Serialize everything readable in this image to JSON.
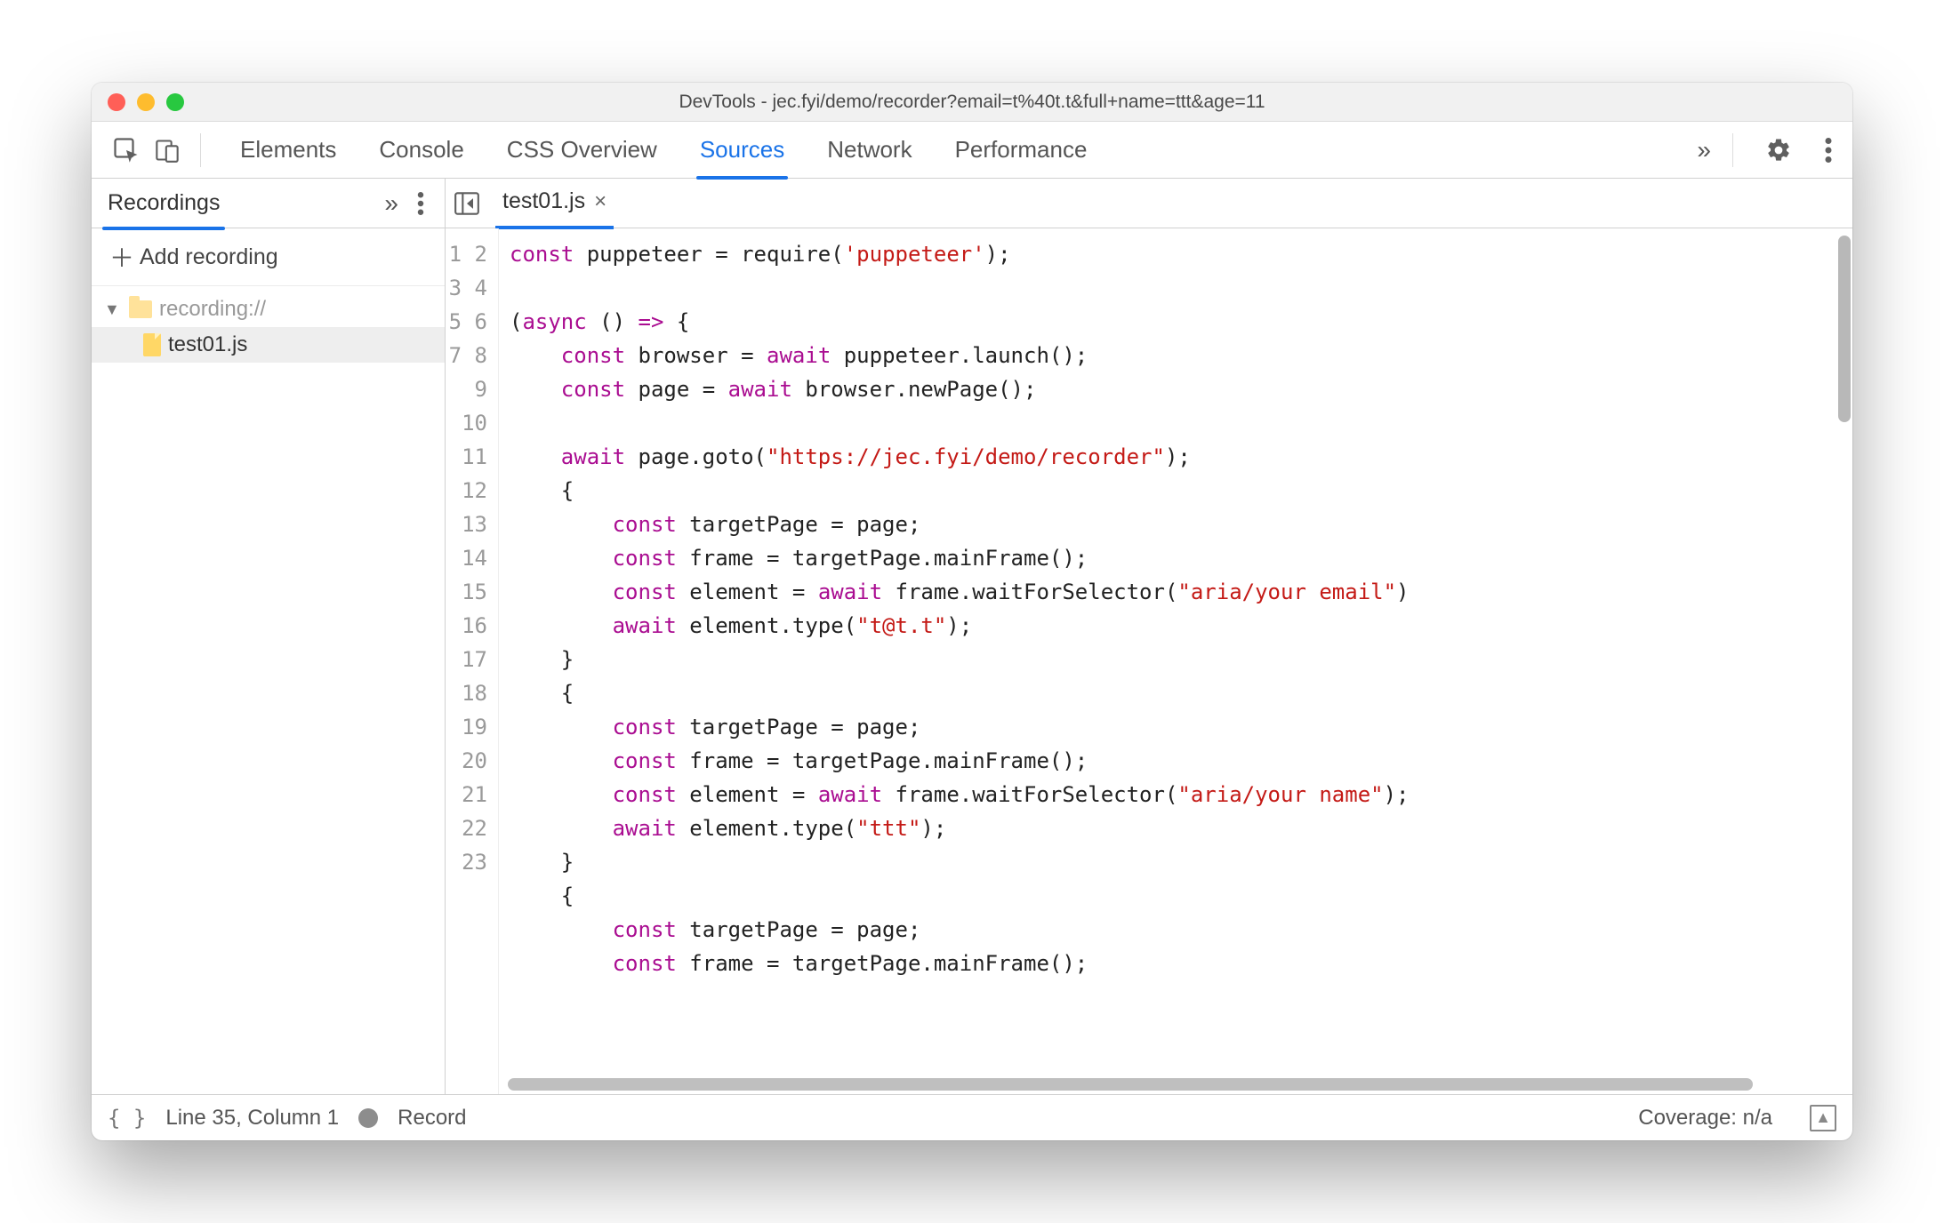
{
  "window": {
    "title": "DevTools - jec.fyi/demo/recorder?email=t%40t.t&full+name=ttt&age=11"
  },
  "toolbar": {
    "tabs": [
      "Elements",
      "Console",
      "CSS Overview",
      "Sources",
      "Network",
      "Performance"
    ],
    "active": "Sources",
    "more": "»"
  },
  "panel": {
    "name": "Recordings",
    "more": "»"
  },
  "add_recording": "Add recording",
  "tree": {
    "root": "recording://",
    "file": "test01.js"
  },
  "file_tab": {
    "name": "test01.js"
  },
  "gutter_start": 1,
  "gutter_end": 23,
  "code": {
    "l1": [
      [
        "kw",
        "const"
      ],
      [
        "punc",
        " "
      ],
      [
        "ident",
        "puppeteer"
      ],
      [
        "punc",
        " = "
      ],
      [
        "ident",
        "require"
      ],
      [
        "punc",
        "("
      ],
      [
        "str",
        "'puppeteer'"
      ],
      [
        "punc",
        ");"
      ]
    ],
    "l2": [],
    "l3": [
      [
        "punc",
        "("
      ],
      [
        "kw",
        "async"
      ],
      [
        "punc",
        " () "
      ],
      [
        "kw",
        "=>"
      ],
      [
        "punc",
        " {"
      ]
    ],
    "l4": [
      [
        "punc",
        "    "
      ],
      [
        "kw",
        "const"
      ],
      [
        "punc",
        " "
      ],
      [
        "ident",
        "browser"
      ],
      [
        "punc",
        " = "
      ],
      [
        "kw",
        "await"
      ],
      [
        "punc",
        " "
      ],
      [
        "ident",
        "puppeteer.launch();"
      ]
    ],
    "l5": [
      [
        "punc",
        "    "
      ],
      [
        "kw",
        "const"
      ],
      [
        "punc",
        " "
      ],
      [
        "ident",
        "page"
      ],
      [
        "punc",
        " = "
      ],
      [
        "kw",
        "await"
      ],
      [
        "punc",
        " "
      ],
      [
        "ident",
        "browser.newPage();"
      ]
    ],
    "l6": [],
    "l7": [
      [
        "punc",
        "    "
      ],
      [
        "kw",
        "await"
      ],
      [
        "punc",
        " "
      ],
      [
        "ident",
        "page.goto("
      ],
      [
        "str",
        "\"https://jec.fyi/demo/recorder\""
      ],
      [
        "punc",
        ");"
      ]
    ],
    "l8": [
      [
        "punc",
        "    {"
      ]
    ],
    "l9": [
      [
        "punc",
        "        "
      ],
      [
        "kw",
        "const"
      ],
      [
        "punc",
        " "
      ],
      [
        "ident",
        "targetPage"
      ],
      [
        "punc",
        " = "
      ],
      [
        "ident",
        "page;"
      ]
    ],
    "l10": [
      [
        "punc",
        "        "
      ],
      [
        "kw",
        "const"
      ],
      [
        "punc",
        " "
      ],
      [
        "ident",
        "frame"
      ],
      [
        "punc",
        " = "
      ],
      [
        "ident",
        "targetPage.mainFrame();"
      ]
    ],
    "l11": [
      [
        "punc",
        "        "
      ],
      [
        "kw",
        "const"
      ],
      [
        "punc",
        " "
      ],
      [
        "ident",
        "element"
      ],
      [
        "punc",
        " = "
      ],
      [
        "kw",
        "await"
      ],
      [
        "punc",
        " "
      ],
      [
        "ident",
        "frame.waitForSelector("
      ],
      [
        "str",
        "\"aria/your email\""
      ],
      [
        "punc",
        ")"
      ]
    ],
    "l12": [
      [
        "punc",
        "        "
      ],
      [
        "kw",
        "await"
      ],
      [
        "punc",
        " "
      ],
      [
        "ident",
        "element.type("
      ],
      [
        "str",
        "\"t@t.t\""
      ],
      [
        "punc",
        ");"
      ]
    ],
    "l13": [
      [
        "punc",
        "    }"
      ]
    ],
    "l14": [
      [
        "punc",
        "    {"
      ]
    ],
    "l15": [
      [
        "punc",
        "        "
      ],
      [
        "kw",
        "const"
      ],
      [
        "punc",
        " "
      ],
      [
        "ident",
        "targetPage"
      ],
      [
        "punc",
        " = "
      ],
      [
        "ident",
        "page;"
      ]
    ],
    "l16": [
      [
        "punc",
        "        "
      ],
      [
        "kw",
        "const"
      ],
      [
        "punc",
        " "
      ],
      [
        "ident",
        "frame"
      ],
      [
        "punc",
        " = "
      ],
      [
        "ident",
        "targetPage.mainFrame();"
      ]
    ],
    "l17": [
      [
        "punc",
        "        "
      ],
      [
        "kw",
        "const"
      ],
      [
        "punc",
        " "
      ],
      [
        "ident",
        "element"
      ],
      [
        "punc",
        " = "
      ],
      [
        "kw",
        "await"
      ],
      [
        "punc",
        " "
      ],
      [
        "ident",
        "frame.waitForSelector("
      ],
      [
        "str",
        "\"aria/your name\""
      ],
      [
        "punc",
        ");"
      ]
    ],
    "l18": [
      [
        "punc",
        "        "
      ],
      [
        "kw",
        "await"
      ],
      [
        "punc",
        " "
      ],
      [
        "ident",
        "element.type("
      ],
      [
        "str",
        "\"ttt\""
      ],
      [
        "punc",
        ");"
      ]
    ],
    "l19": [
      [
        "punc",
        "    }"
      ]
    ],
    "l20": [
      [
        "punc",
        "    {"
      ]
    ],
    "l21": [
      [
        "punc",
        "        "
      ],
      [
        "kw",
        "const"
      ],
      [
        "punc",
        " "
      ],
      [
        "ident",
        "targetPage"
      ],
      [
        "punc",
        " = "
      ],
      [
        "ident",
        "page;"
      ]
    ],
    "l22": [
      [
        "punc",
        "        "
      ],
      [
        "kw",
        "const"
      ],
      [
        "punc",
        " "
      ],
      [
        "ident",
        "frame"
      ],
      [
        "punc",
        " = "
      ],
      [
        "ident",
        "targetPage.mainFrame();"
      ]
    ]
  },
  "status": {
    "cursor": "Line 35, Column 1",
    "record": "Record",
    "coverage": "Coverage: n/a"
  }
}
